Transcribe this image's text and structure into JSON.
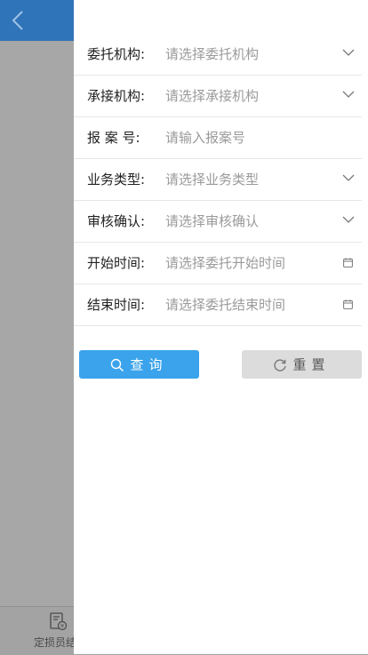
{
  "background": {
    "tab_label": "定损员结",
    "header_color": "#2f74b8"
  },
  "form": {
    "fields": [
      {
        "label": "委托机构:",
        "placeholder": "请选择委托机构",
        "control": "dropdown"
      },
      {
        "label": "承接机构:",
        "placeholder": "请选择承接机构",
        "control": "dropdown"
      },
      {
        "label": "报  案  号:",
        "placeholder": "请输入报案号",
        "control": "text"
      },
      {
        "label": "业务类型:",
        "placeholder": "请选择业务类型",
        "control": "dropdown"
      },
      {
        "label": "审核确认:",
        "placeholder": "请选择审核确认",
        "control": "dropdown"
      },
      {
        "label": "开始时间:",
        "placeholder": "请选择委托开始时间",
        "control": "date"
      },
      {
        "label": "结束时间:",
        "placeholder": "请选择委托结束时间",
        "control": "date"
      }
    ]
  },
  "buttons": {
    "query_label": "查询",
    "reset_label": "重置",
    "query_color": "#3aa3eb"
  }
}
